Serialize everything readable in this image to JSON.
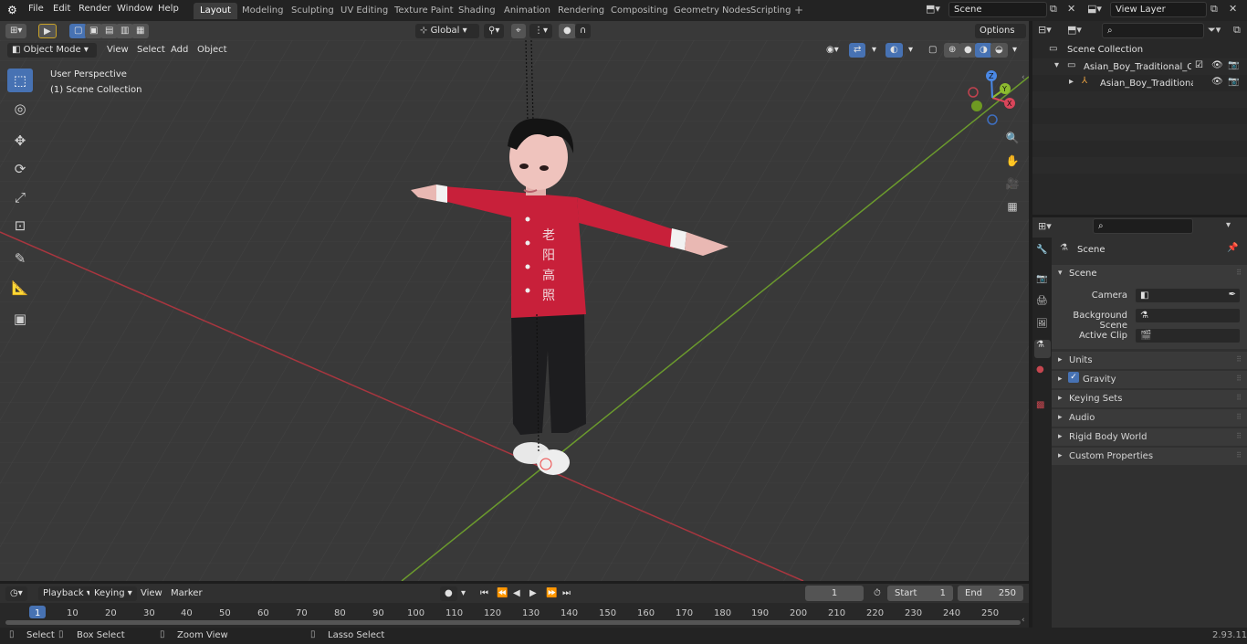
{
  "app": {
    "version": "2.93.11"
  },
  "menu": [
    "File",
    "Edit",
    "Render",
    "Window",
    "Help"
  ],
  "workspaces": [
    "Layout",
    "Modeling",
    "Sculpting",
    "UV Editing",
    "Texture Paint",
    "Shading",
    "Animation",
    "Rendering",
    "Compositing",
    "Geometry Nodes",
    "Scripting"
  ],
  "active_workspace": "Layout",
  "scene_field": "Scene",
  "view_layer_field": "View Layer",
  "viewport_header": {
    "mode": "Object Mode",
    "menus": [
      "View",
      "Select",
      "Add",
      "Object"
    ],
    "transform_orientation": "Global",
    "options": "Options"
  },
  "overlay_text": {
    "perspective": "User Perspective",
    "collection": "(1) Scene Collection"
  },
  "gizmo": {
    "x": "X",
    "y": "Y",
    "z": "Z"
  },
  "shirt_text": [
    "老",
    "阳",
    "高",
    "照"
  ],
  "outliner": {
    "root": "Scene Collection",
    "items": [
      {
        "label": "Asian_Boy_Traditional_Costur"
      },
      {
        "label": "Asian_Boy_Traditional_C"
      }
    ]
  },
  "properties": {
    "context": "Scene",
    "panel": "Scene",
    "fields": [
      {
        "label": "Camera"
      },
      {
        "label": "Background Scene"
      },
      {
        "label": "Active Clip"
      }
    ],
    "subpanels": [
      {
        "label": "Units"
      },
      {
        "label": "Gravity"
      },
      {
        "label": "Keying Sets"
      },
      {
        "label": "Audio"
      },
      {
        "label": "Rigid Body World"
      },
      {
        "label": "Custom Properties"
      }
    ]
  },
  "timeline": {
    "menus": [
      "Playback",
      "Keying",
      "View",
      "Marker"
    ],
    "current_frame": "1",
    "start_label": "Start",
    "start": "1",
    "end_label": "End",
    "end": "250",
    "ticks": [
      "1",
      "10",
      "20",
      "30",
      "40",
      "50",
      "60",
      "70",
      "80",
      "90",
      "100",
      "110",
      "120",
      "130",
      "140",
      "150",
      "160",
      "170",
      "180",
      "190",
      "200",
      "210",
      "220",
      "230",
      "240",
      "250"
    ]
  },
  "status": {
    "select": "Select",
    "box_select": "Box Select",
    "zoom_view": "Zoom View",
    "lasso_select": "Lasso Select"
  },
  "colors": {
    "accent": "#4772b3",
    "x_axis": "#a8363f",
    "y_axis": "#6b9a2d",
    "shirt": "#c8203a"
  }
}
